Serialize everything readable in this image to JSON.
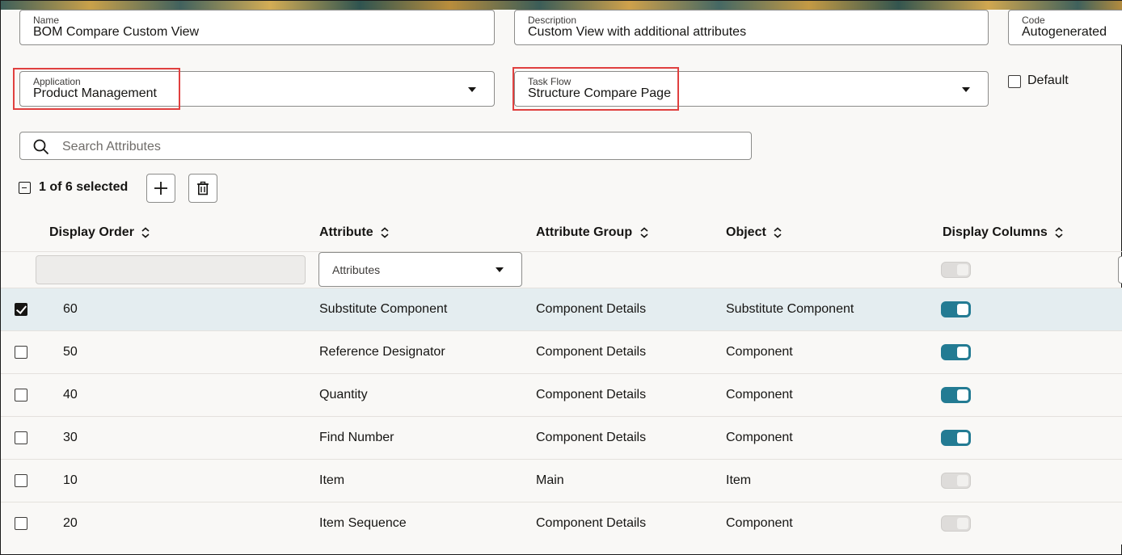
{
  "form": {
    "name": {
      "label": "Name",
      "value": "BOM Compare Custom View"
    },
    "description": {
      "label": "Description",
      "value": "Custom View with additional attributes"
    },
    "code": {
      "label": "Code",
      "value": "Autogenerated"
    },
    "application": {
      "label": "Application",
      "value": "Product Management"
    },
    "task_flow": {
      "label": "Task Flow",
      "value": "Structure Compare Page"
    },
    "default": {
      "label": "Default",
      "checked": false
    }
  },
  "search": {
    "placeholder": "Search Attributes"
  },
  "toolbar": {
    "selection_text": "1 of 6 selected",
    "add_icon": "plus-icon",
    "delete_icon": "trash-icon"
  },
  "table": {
    "columns": [
      "Display Order",
      "Attribute",
      "Attribute Group",
      "Object",
      "Display Columns"
    ],
    "filter": {
      "attribute_select": "Attributes",
      "display_columns_toggle": false
    },
    "rows": [
      {
        "selected": true,
        "display_order": "60",
        "attribute": "Substitute Component",
        "attribute_group": "Component Details",
        "object": "Substitute Component",
        "display": true
      },
      {
        "selected": false,
        "display_order": "50",
        "attribute": "Reference Designator",
        "attribute_group": "Component Details",
        "object": "Component",
        "display": true
      },
      {
        "selected": false,
        "display_order": "40",
        "attribute": "Quantity",
        "attribute_group": "Component Details",
        "object": "Component",
        "display": true
      },
      {
        "selected": false,
        "display_order": "30",
        "attribute": "Find Number",
        "attribute_group": "Component Details",
        "object": "Component",
        "display": true
      },
      {
        "selected": false,
        "display_order": "10",
        "attribute": "Item",
        "attribute_group": "Main",
        "object": "Item",
        "display": false
      },
      {
        "selected": false,
        "display_order": "20",
        "attribute": "Item Sequence",
        "attribute_group": "Component Details",
        "object": "Component",
        "display": false
      }
    ]
  },
  "colors": {
    "accent": "#237b93",
    "highlight": "#e0403f",
    "selected_row": "#e4edf0"
  }
}
